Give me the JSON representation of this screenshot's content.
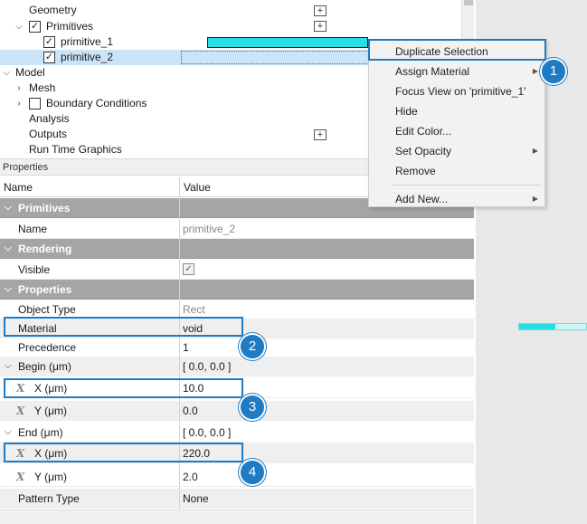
{
  "tree": {
    "items": [
      {
        "label": "Geometry",
        "caret": "",
        "checked": null,
        "plus": true
      },
      {
        "label": "Primitives",
        "caret": "⌵",
        "checked": "✓",
        "plus": true
      },
      {
        "label": "primitive_1",
        "caret": "",
        "checked": "✓",
        "plus": false
      },
      {
        "label": "primitive_2",
        "caret": "",
        "checked": "✓",
        "plus": false
      },
      {
        "label": "Model",
        "caret": "⌵",
        "checked": null,
        "plus": false
      },
      {
        "label": "Mesh",
        "caret": "›",
        "checked": null,
        "plus": false
      },
      {
        "label": "Boundary Conditions",
        "caret": "›",
        "checked": "",
        "plus": false
      },
      {
        "label": "Analysis",
        "caret": "",
        "checked": null,
        "plus": false
      },
      {
        "label": "Outputs",
        "caret": "",
        "checked": null,
        "plus": true
      },
      {
        "label": "Run Time Graphics",
        "caret": "",
        "checked": null,
        "plus": false
      }
    ],
    "plus_glyph": "+",
    "primitive_color": "#27e0e6"
  },
  "properties": {
    "panel_title": "Properties",
    "col_name": "Name",
    "col_value": "Value",
    "rows": {
      "g_primitives": "Primitives",
      "name_label": "Name",
      "name_value": "primitive_2",
      "g_rendering": "Rendering",
      "visible_label": "Visible",
      "visible_check": "✓",
      "g_properties": "Properties",
      "objtype_label": "Object Type",
      "objtype_value": "Rect",
      "material_label": "Material",
      "material_value": "void",
      "precedence_label": "Precedence",
      "precedence_value": "1",
      "begin_label": "Begin (μm)",
      "begin_value": "[ 0.0, 0.0 ]",
      "bx_label": "X (μm)",
      "bx_value": "10.0",
      "by_label": "Y (μm)",
      "by_value": "0.0",
      "end_label": "End (μm)",
      "end_value": "[ 0.0, 0.0 ]",
      "ex_label": "X (μm)",
      "ex_value": "220.0",
      "ey_label": "Y (μm)",
      "ey_value": "2.0",
      "pattern_label": "Pattern Type",
      "pattern_value": "None"
    },
    "x_icon": "X",
    "group_caret": "⌵"
  },
  "context_menu": {
    "items": [
      {
        "label": "Duplicate Selection",
        "submenu": false
      },
      {
        "label": "Assign Material",
        "submenu": true
      },
      {
        "label": "Focus View on 'primitive_1'",
        "submenu": false
      },
      {
        "label": "Hide",
        "submenu": false
      },
      {
        "label": "Edit Color...",
        "submenu": false
      },
      {
        "label": "Set Opacity",
        "submenu": true
      },
      {
        "label": "Remove",
        "submenu": false
      },
      {
        "label": "Add New...",
        "submenu": true
      }
    ],
    "submenu_arrow": "▶"
  },
  "callouts": [
    "1",
    "2",
    "3",
    "4"
  ],
  "accent_color": "#1f7bc4"
}
